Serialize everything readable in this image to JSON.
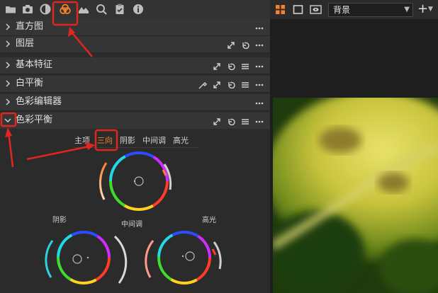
{
  "toolbar": {
    "icons": [
      "folder-icon",
      "camera-icon",
      "circle-half-icon",
      "color-balance-icon",
      "tag-icon",
      "search-icon",
      "clipboard-check-icon",
      "info-icon"
    ]
  },
  "sections": [
    {
      "label": "直方图",
      "expanded": false
    },
    {
      "label": "图层",
      "expanded": false
    },
    {
      "label": "基本特征",
      "expanded": false
    },
    {
      "label": "白平衡",
      "expanded": false
    },
    {
      "label": "色彩编辑器",
      "expanded": false
    },
    {
      "label": "色彩平衡",
      "expanded": true
    }
  ],
  "color_balance": {
    "tabs": [
      "主项",
      "三向",
      "阴影",
      "中间调",
      "高光"
    ],
    "active_tab": "三向",
    "wheels": {
      "shadow_label": "阴影",
      "midtone_label": "中间调",
      "highlight_label": "高光"
    }
  },
  "right_panel": {
    "layer_select": "背景",
    "add_label": "+"
  },
  "colors": {
    "accent": "#f5822a",
    "annotation_red": "#e0261e"
  }
}
